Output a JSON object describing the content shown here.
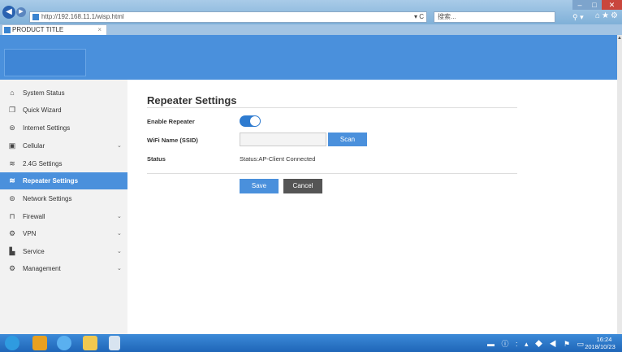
{
  "browser": {
    "url": "http://192.168.11.1/wisp.html",
    "search_placeholder": "搜索...",
    "tab_title": "PRODUCT TITLE",
    "tab_close": "×",
    "back_glyph": "◀",
    "forward_glyph": "▶",
    "refresh_glyph": "▾ C",
    "search_icon_glyph": "⚲ ▾",
    "toolbar_glyphs": "⌂★⚙",
    "minimize_glyph": "–",
    "maximize_glyph": "□",
    "close_glyph": "✕"
  },
  "sidebar": {
    "items": [
      {
        "label": "System Status",
        "icon": "home-icon",
        "glyph": "⌂"
      },
      {
        "label": "Quick Wizard",
        "icon": "window-icon",
        "glyph": "❐"
      },
      {
        "label": "Internet Settings",
        "icon": "globe-icon",
        "glyph": "⊜"
      },
      {
        "label": "Cellular",
        "icon": "sim-card-icon",
        "glyph": "▣",
        "chevron": "⌄"
      },
      {
        "label": "2.4G Settings",
        "icon": "wifi-icon",
        "glyph": "≋"
      },
      {
        "label": "Repeater Settings",
        "icon": "wifi-icon",
        "glyph": "≋",
        "active": true
      },
      {
        "label": "Network Settings",
        "icon": "globe-icon",
        "glyph": "⊜"
      },
      {
        "label": "Firewall",
        "icon": "lock-icon",
        "glyph": "⊓",
        "chevron": "⌄"
      },
      {
        "label": "VPN",
        "icon": "gear-icon",
        "glyph": "⚙",
        "chevron": "⌄"
      },
      {
        "label": "Service",
        "icon": "bar-chart-icon",
        "glyph": "▙",
        "chevron": "⌄"
      },
      {
        "label": "Management",
        "icon": "gear-icon",
        "glyph": "⚙",
        "chevron": "⌄"
      }
    ]
  },
  "main": {
    "title": "Repeater Settings",
    "enable_label": "Enable Repeater",
    "enable_value": true,
    "ssid_label": "WiFi Name (SSID)",
    "ssid_value": "",
    "scan_label": "Scan",
    "status_label": "Status",
    "status_value": "Status:AP-Client Connected",
    "save_label": "Save",
    "cancel_label": "Cancel"
  },
  "taskbar": {
    "tray_glyphs": "▬ ⓘ : ▴ ◆ ◀ ⚑ ▭",
    "time": "16:24",
    "date": "2018/10/23"
  },
  "colors": {
    "accent": "#4a90dc",
    "header": "#4a90dc",
    "cancel": "#555555",
    "sidebar_bg": "#f2f2f2"
  }
}
